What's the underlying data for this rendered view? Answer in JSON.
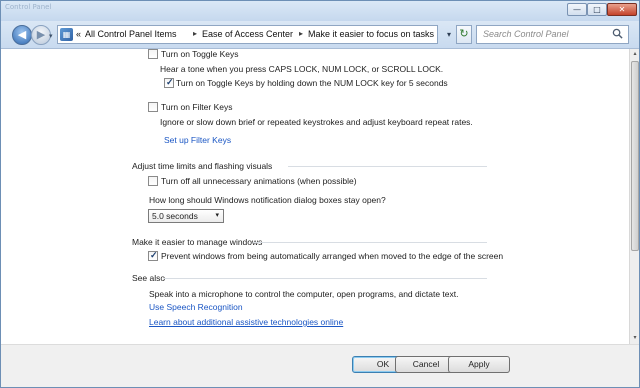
{
  "titlebar": {
    "ghost_text": "Control Panel",
    "min_glyph": "—",
    "max_glyph": "□",
    "close_glyph": "✕"
  },
  "nav": {
    "back_glyph": "◀",
    "forward_glyph": "▶",
    "history_glyph": "▾",
    "crumb_prefix": "«",
    "breadcrumbs": [
      "All Control Panel Items",
      "Ease of Access Center",
      "Make it easier to focus on tasks"
    ],
    "crumb_sep": "▸",
    "address_dropdown_glyph": "▾",
    "refresh_glyph": "↻",
    "search_placeholder": "Search Control Panel"
  },
  "content": {
    "toggle_keys": {
      "checkbox_label": "Turn on Toggle Keys",
      "description": "Hear a tone when you press CAPS LOCK, NUM LOCK, or SCROLL LOCK.",
      "sub_checkbox_label": "Turn on Toggle Keys by holding down the NUM LOCK key for 5 seconds",
      "sub_checked": true,
      "checked": false
    },
    "filter_keys": {
      "checkbox_label": "Turn on Filter Keys",
      "description": "Ignore or slow down brief or repeated keystrokes and adjust keyboard repeat rates.",
      "link": "Set up Filter Keys",
      "checked": false
    },
    "time_limits": {
      "heading": "Adjust time limits and flashing visuals",
      "animations_label": "Turn off all unnecessary animations (when possible)",
      "animations_checked": false,
      "dialog_question": "How long should Windows notification dialog boxes stay open?",
      "dialog_duration": "5.0 seconds",
      "dropdown_glyph": "▾"
    },
    "manage_windows": {
      "heading": "Make it easier to manage windows",
      "prevent_label": "Prevent windows from being automatically arranged when moved to the edge of the screen",
      "prevent_checked": true
    },
    "see_also": {
      "heading": "See also",
      "speech_description": "Speak into a microphone to control the computer, open programs, and dictate text.",
      "speech_link": "Use Speech Recognition",
      "assistive_link": "Learn about additional assistive technologies online"
    },
    "check_glyph": "✓"
  },
  "scrollbar": {
    "up_glyph": "▴",
    "down_glyph": "▾"
  },
  "footer": {
    "ok_label": "OK",
    "cancel_label": "Cancel",
    "apply_label": "Apply"
  },
  "colors": {
    "link": "#1a56c4",
    "titlebar": "#c5d8ee",
    "close": "#c4432b"
  }
}
